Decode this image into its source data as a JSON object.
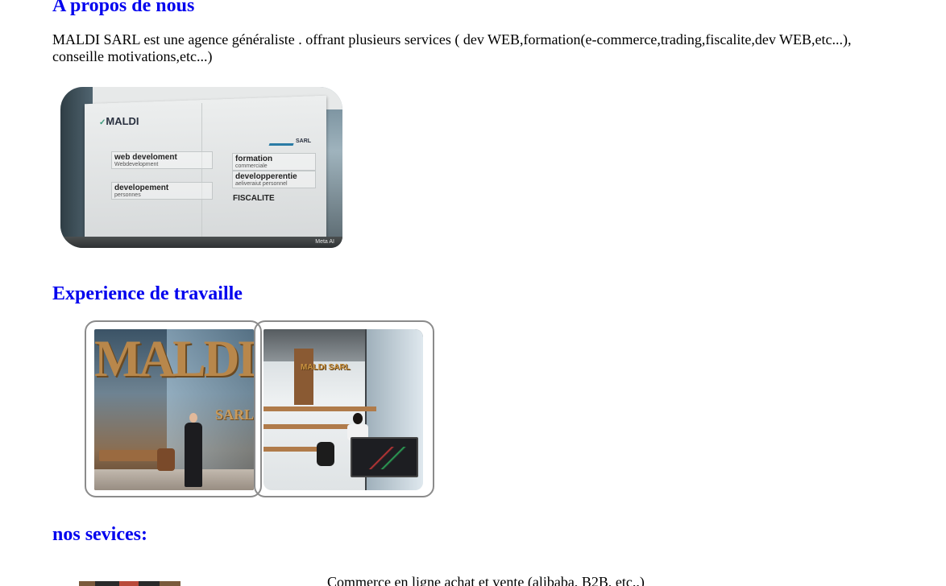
{
  "about": {
    "title": "A propos de nous",
    "text": "MALDI SARL est une agence généraliste . offrant plusieurs services ( dev WEB,formation(e-commerce,trading,fiscalite,dev WEB,etc...), conseille motivations,etc...)",
    "image": {
      "brand": "MALDI",
      "brand_right": "SARL",
      "tiles": [
        {
          "title": "web develoment",
          "sub": "Webdevelopment"
        },
        {
          "title": "developement",
          "sub": "personnes"
        },
        {
          "title": "formation",
          "sub": "commerciale"
        },
        {
          "title": "developperentie",
          "sub": "aeliveraiut personnel"
        },
        {
          "title": "FISCALITE",
          "sub": ""
        }
      ],
      "watermark": "Meta AI"
    }
  },
  "experience": {
    "title": "Experience de travaille",
    "photos": [
      {
        "overlay_big": "MALDI",
        "overlay_small": "SARL"
      },
      {
        "overlay_big": "MALDI SARL"
      }
    ]
  },
  "services": {
    "title": "nos sevices:",
    "first_item": "Commerce en ligne achat et vente (alibaba, B2B, etc..)"
  }
}
